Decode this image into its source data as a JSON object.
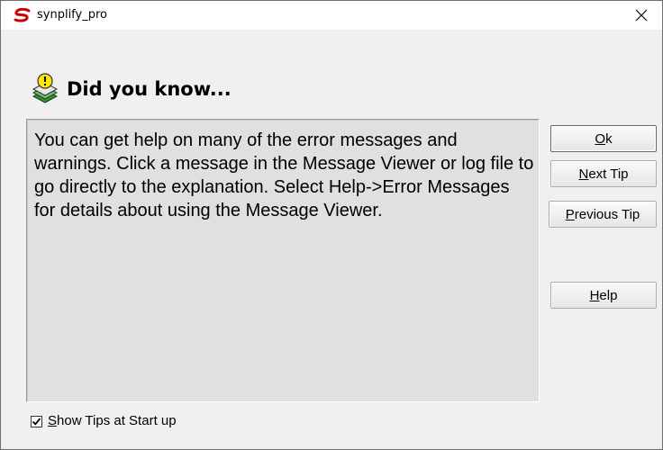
{
  "window": {
    "title": "synplify_pro",
    "close_glyph": "×",
    "app_icon": "synplify-logo-icon",
    "accent_color": "#cc0000"
  },
  "header": {
    "icon": "lightbulb-tip-icon",
    "title": "Did you know..."
  },
  "tip": {
    "text": "You can get help on many of the error messages and warnings. Click a message in the Message Viewer or log file to go directly to the explanation. Select Help->Error Messages for details about using the Message Viewer."
  },
  "buttons": {
    "ok": {
      "mnemonic": "O",
      "rest": "k"
    },
    "next_tip": {
      "mnemonic": "N",
      "rest": "ext Tip"
    },
    "previous_tip": {
      "mnemonic": "P",
      "rest": "revious Tip"
    },
    "help": {
      "mnemonic": "H",
      "rest": "elp"
    }
  },
  "footer": {
    "show_tips_checked": true,
    "show_tips_mark": "✓",
    "show_tips_label_mnemonic": "S",
    "show_tips_label_rest": "how Tips at Start up"
  }
}
